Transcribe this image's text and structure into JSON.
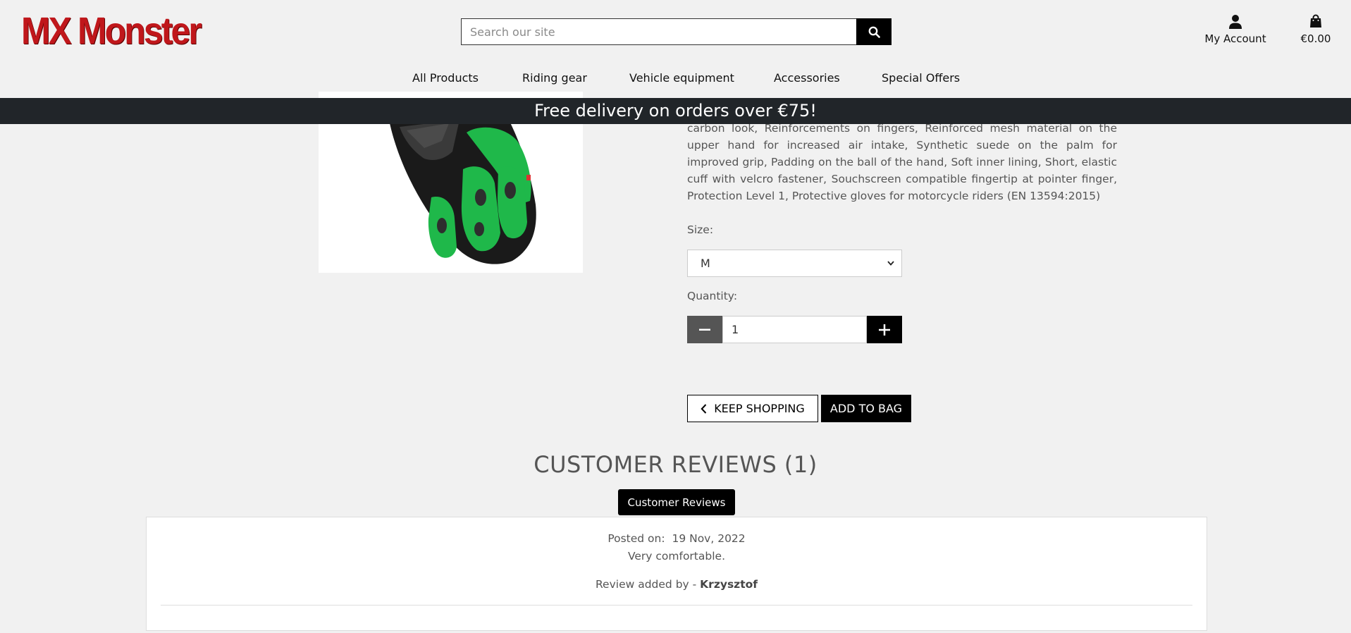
{
  "brand": {
    "logo_text": "MX Monster"
  },
  "search": {
    "placeholder": "Search our site"
  },
  "account": {
    "label": "My Account"
  },
  "cart": {
    "total": "€0.00"
  },
  "nav": [
    {
      "label": "All Products"
    },
    {
      "label": "Riding gear"
    },
    {
      "label": "Vehicle equipment"
    },
    {
      "label": "Accessories"
    },
    {
      "label": "Special Offers"
    }
  ],
  "banner": {
    "text": "Free delivery on orders over €75!"
  },
  "product": {
    "description_visible": "carbon look, Reinforcements on fingers, Reinforced mesh material on the upper hand for increased air intake, Synthetic suede on the palm for improved grip, Padding on the ball of the hand, Soft inner lining, Short, elastic cuff with velcro fastener, Souchscreen compatible fingertip at pointer finger, Protection Level 1, Protective gloves for motorcycle riders (EN 13594:2015)",
    "size_label": "Size:",
    "size_value": "M",
    "quantity_label": "Quantity:",
    "quantity_value": "1",
    "keep_shopping_label": "KEEP SHOPPING",
    "add_to_bag_label": "ADD TO BAG"
  },
  "reviews": {
    "title": "CUSTOMER REVIEWS (1)",
    "tab_label": "Customer Reviews",
    "items": [
      {
        "posted_prefix": "Posted on:",
        "date": "19 Nov, 2022",
        "text": "Very comfortable.",
        "added_by_prefix": "Review added by -",
        "author": "Krzysztof"
      }
    ]
  },
  "colors": {
    "logo_red": "#c0171b",
    "banner_bg": "#212529",
    "glove_green": "#1fb84a",
    "page_bg": "#f1f1f1"
  }
}
